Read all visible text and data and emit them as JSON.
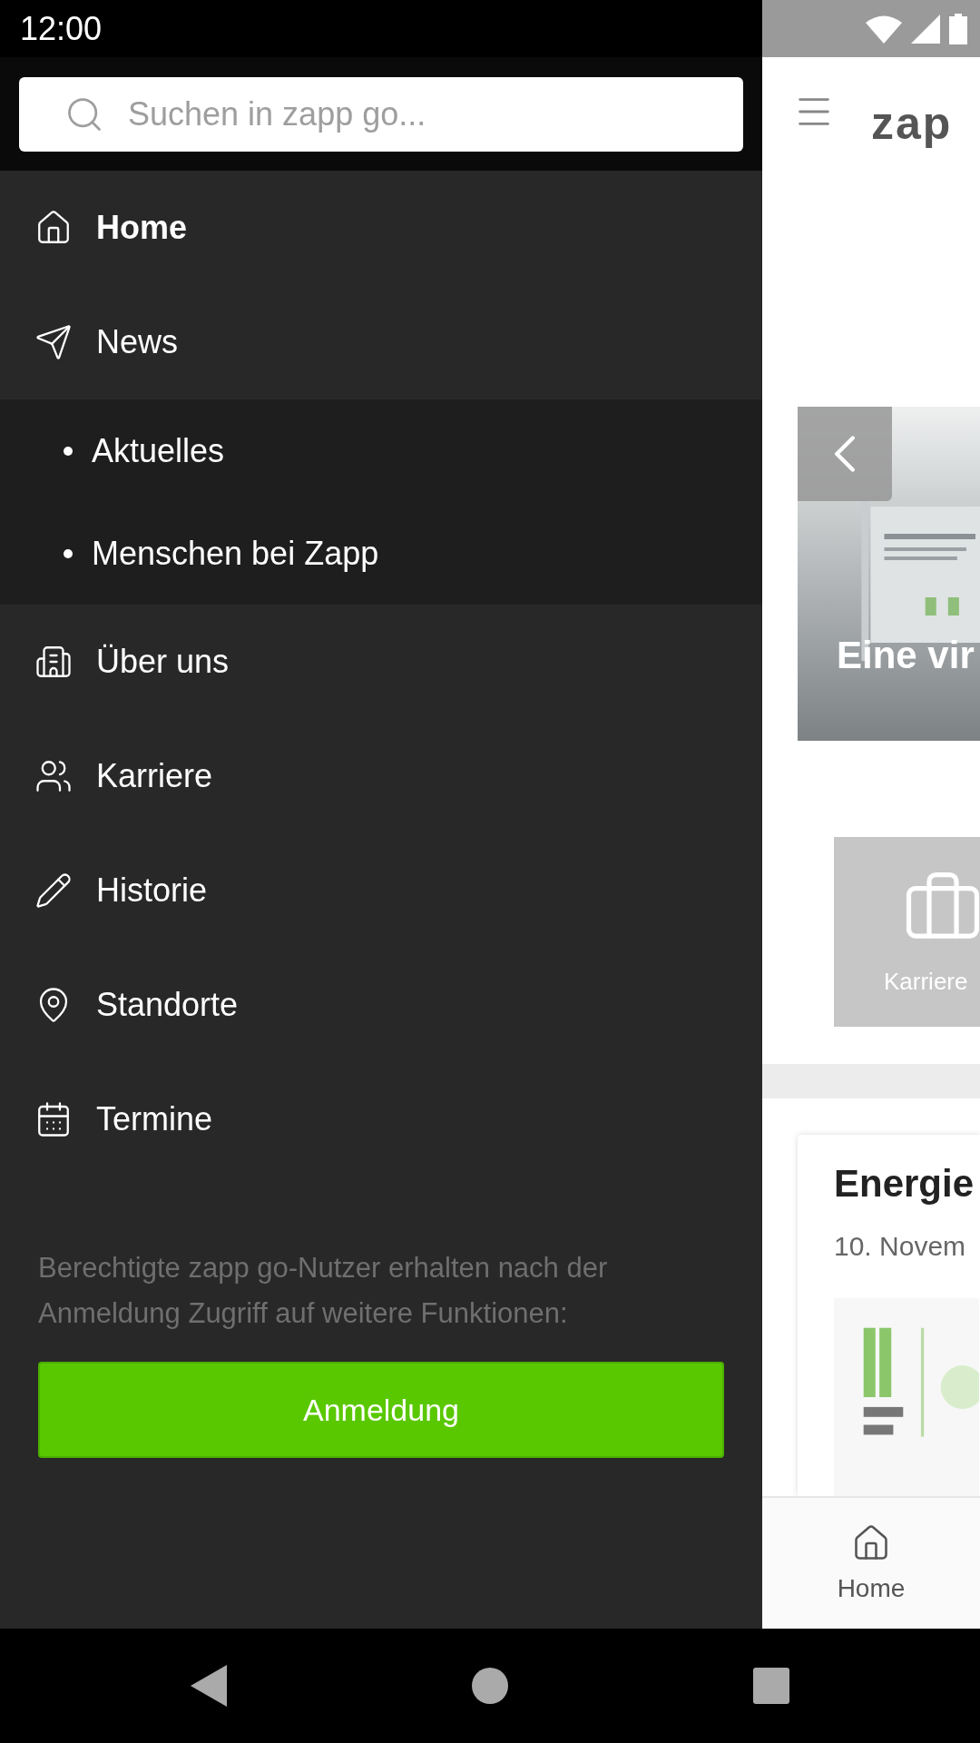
{
  "status_bar": {
    "time": "12:00"
  },
  "drawer": {
    "search": {
      "placeholder": "Suchen in zapp go..."
    },
    "menu": [
      {
        "label": "Home",
        "selected": true
      },
      {
        "label": "News",
        "selected": false,
        "expanded": true,
        "children": [
          {
            "label": "Aktuelles",
            "selected": false
          },
          {
            "label": "Menschen bei Zapp",
            "selected": false
          }
        ]
      },
      {
        "label": "Über uns",
        "selected": false
      },
      {
        "label": "Karriere",
        "selected": false
      },
      {
        "label": "Historie",
        "selected": false
      },
      {
        "label": "Standorte",
        "selected": false
      },
      {
        "label": "Termine",
        "selected": false
      }
    ],
    "notice": "Berechtigte zapp go-Nutzer erhalten nach der Anmeldung Zugriff auf weitere Funktionen:",
    "login_button": "Anmeldung"
  },
  "content": {
    "logo": "zap",
    "hero": {
      "title": "Eine vir"
    },
    "tile": {
      "label": "Karriere"
    },
    "news_card": {
      "title": "Energie",
      "date": "10. Novem"
    },
    "tab_bar": [
      {
        "label": "Home",
        "selected": true
      }
    ]
  }
}
